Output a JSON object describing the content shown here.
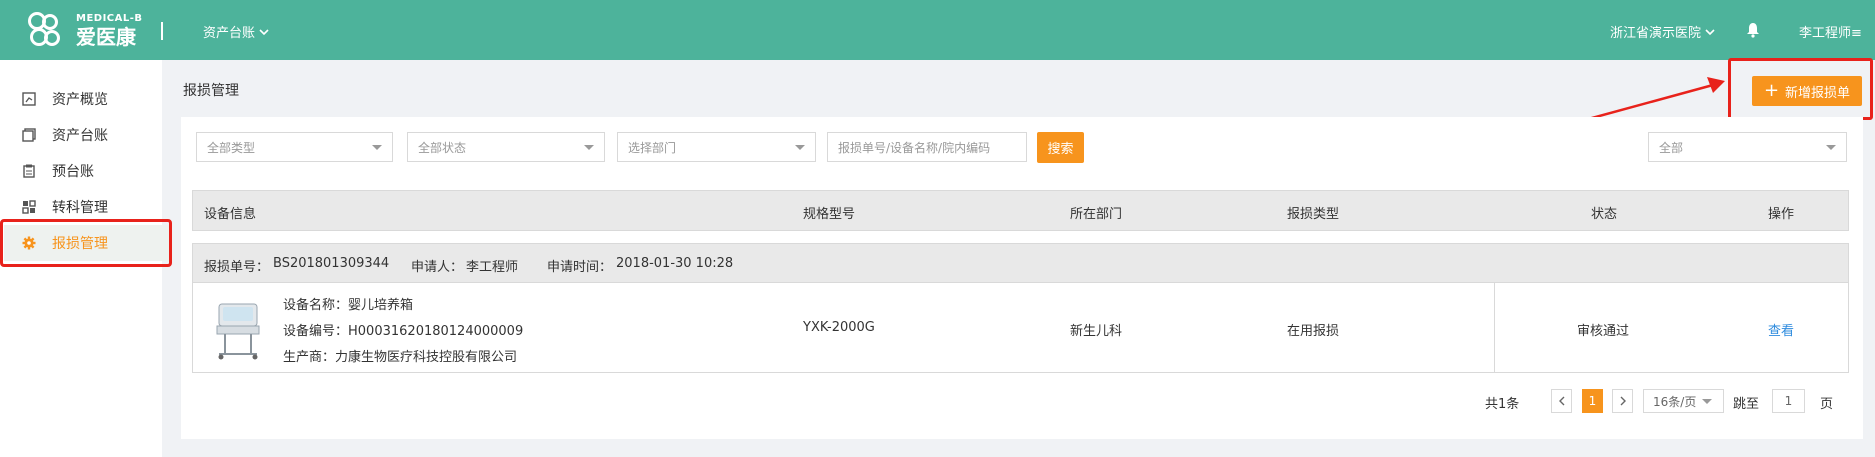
{
  "header": {
    "logo_en": "MEDICAL-B",
    "logo_cn": "爱医康",
    "nav_menu": "资产台账",
    "hospital": "浙江省演示医院",
    "user": "李工程师"
  },
  "sidebar": {
    "items": [
      {
        "label": "资产概览",
        "icon": "overview-icon"
      },
      {
        "label": "资产台账",
        "icon": "ledger-icon"
      },
      {
        "label": "预台账",
        "icon": "pre-ledger-icon"
      },
      {
        "label": "转科管理",
        "icon": "transfer-icon"
      },
      {
        "label": "报损管理",
        "icon": "gear-icon"
      }
    ],
    "active_index": 4
  },
  "page": {
    "title": "报损管理",
    "new_button": "新增报损单"
  },
  "filters": {
    "type": "全部类型",
    "status": "全部状态",
    "department": "选择部门",
    "search_placeholder": "报损单号/设备名称/院内编码",
    "search_button": "搜索",
    "scope": "全部"
  },
  "table": {
    "columns": [
      "设备信息",
      "规格型号",
      "所在部门",
      "报损类型",
      "状态",
      "操作"
    ],
    "groups": [
      {
        "order_no_label": "报损单号：",
        "order_no": "BS201801309344",
        "applicant_label": "申请人：",
        "applicant": "李工程师",
        "time_label": "申请时间：",
        "time": "2018-01-30 10:28",
        "device_name_label": "设备名称：",
        "device_name": "婴儿培养箱",
        "device_code_label": "设备编号：",
        "device_code": "H00031620180124000009",
        "maker_label": "生产商：",
        "maker": "力康生物医疗科技控股有限公司",
        "model": "YXK-2000G",
        "department": "新生儿科",
        "damage_type": "在用报损",
        "status": "审核通过",
        "action": "查看"
      }
    ]
  },
  "pagination": {
    "total": "共1条",
    "current_page": "1",
    "page_size": "16条/页",
    "jump_label": "跳至",
    "jump_value": "1",
    "page_unit": "页"
  },
  "colors": {
    "header": "#4db39b",
    "accent": "#f7941d",
    "annotation": "#e8221b",
    "link": "#2e8bde"
  }
}
